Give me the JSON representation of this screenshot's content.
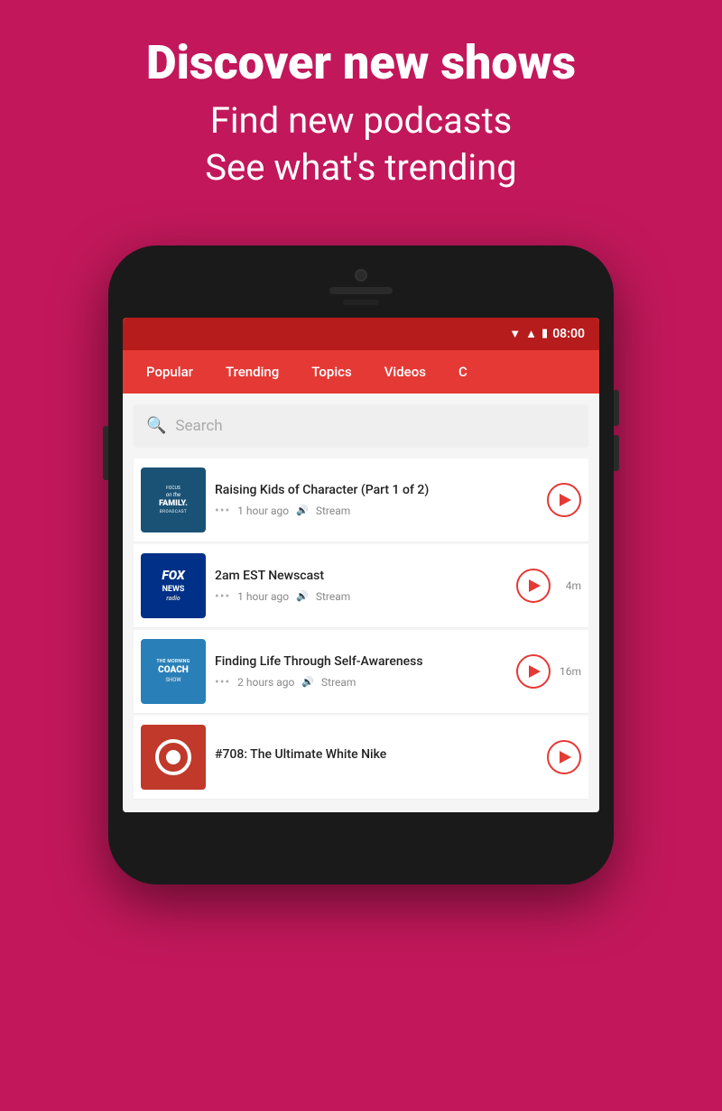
{
  "hero": {
    "title": "Discover new shows",
    "subtitle_line1": "Find new podcasts",
    "subtitle_line2": "See what's trending"
  },
  "status_bar": {
    "time": "08:00"
  },
  "nav_tabs": [
    {
      "label": "Popular"
    },
    {
      "label": "Trending"
    },
    {
      "label": "Topics"
    },
    {
      "label": "Videos"
    },
    {
      "label": "C"
    }
  ],
  "search": {
    "placeholder": "Search"
  },
  "podcasts": [
    {
      "id": "focus",
      "title": "Raising Kids of Character (Part 1 of 2)",
      "thumb_line1": "FOCUS",
      "thumb_line2": "on the FAMILY.",
      "thumb_line3": "BROADCAST",
      "time_ago": "1 hour ago",
      "stream_label": "Stream",
      "duration": ""
    },
    {
      "id": "fox",
      "title": "2am EST Newscast",
      "thumb_line1": "FOX",
      "thumb_line2": "NEWS",
      "thumb_line3": "radio",
      "time_ago": "1 hour ago",
      "stream_label": "Stream",
      "duration": "4m"
    },
    {
      "id": "morning",
      "title": "Finding Life Through Self-Awareness",
      "thumb_line1": "THE MORNING",
      "thumb_line2": "COACH",
      "thumb_line3": "SHOW",
      "time_ago": "2 hours ago",
      "stream_label": "Stream",
      "duration": "16m"
    },
    {
      "id": "red",
      "title": "#708: The Ultimate White Nike",
      "thumb_line1": "",
      "time_ago": "",
      "stream_label": "",
      "duration": ""
    }
  ]
}
